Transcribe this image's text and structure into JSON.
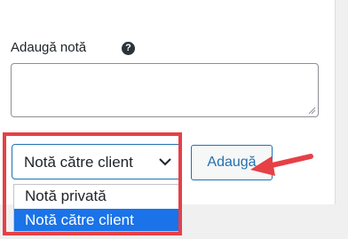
{
  "note": {
    "label": "Adaugă notă",
    "help_icon": "question-mark-icon",
    "textarea_value": ""
  },
  "note_type": {
    "selected": "Notă către client",
    "options": [
      "Notă privată",
      "Notă către client"
    ],
    "highlighted_option": 1
  },
  "add_button": {
    "label": "Adaugă"
  },
  "colors": {
    "highlight_border": "#e64046",
    "arrow": "#e64046",
    "selected_option_bg": "#1a73e8",
    "link_blue": "#2271b1"
  }
}
